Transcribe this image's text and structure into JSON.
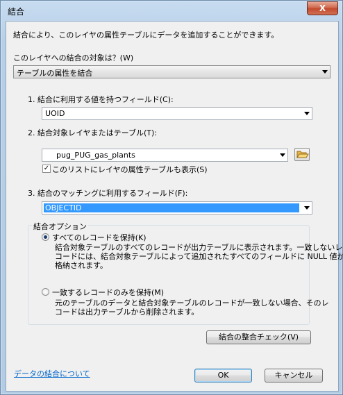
{
  "window": {
    "title": "結合",
    "close_label": "X"
  },
  "intro": "結合により、このレイヤの属性テーブルにデータを追加することができます。",
  "join_target": {
    "label": "このレイヤへの結合の対象は？(W)",
    "selected": "テーブルの属性を結合"
  },
  "step1": {
    "label": "1.  結合に利用する値を持つフィールド(C):",
    "selected": "UOID"
  },
  "step2": {
    "label": "2.  結合対象レイヤまたはテーブル(T):",
    "selected": "pug_PUG_gas_plants",
    "checkbox_label": "このリストにレイヤの属性テーブルも表示(S)",
    "checkbox_checked": true
  },
  "step3": {
    "label": "3.  結合のマッチングに利用するフィールド(F):",
    "selected": "OBJECTID"
  },
  "options": {
    "title": "結合オプション",
    "keep_all_label": "すべてのレコードを保持(K)",
    "keep_all_desc": [
      "結合対象テーブルのすべてのレコードが出力テーブルに表示されます。一致しないレ",
      "コードには、結合対象テーブルによって追加されたすべてのフィールドに NULL 値が",
      "格納されます。"
    ],
    "keep_match_label": "一致するレコードのみを保持(M)",
    "keep_match_desc": [
      "元のテーブルのデータと結合対象テーブルのレコードが一致しない場合、そのレ",
      "コードは出力テーブルから削除されます。"
    ],
    "selected": "keep_all"
  },
  "validate_button": "結合の整合チェック(V)",
  "help_link": "データの結合について",
  "ok_button": "OK",
  "cancel_button": "キャンセル"
}
